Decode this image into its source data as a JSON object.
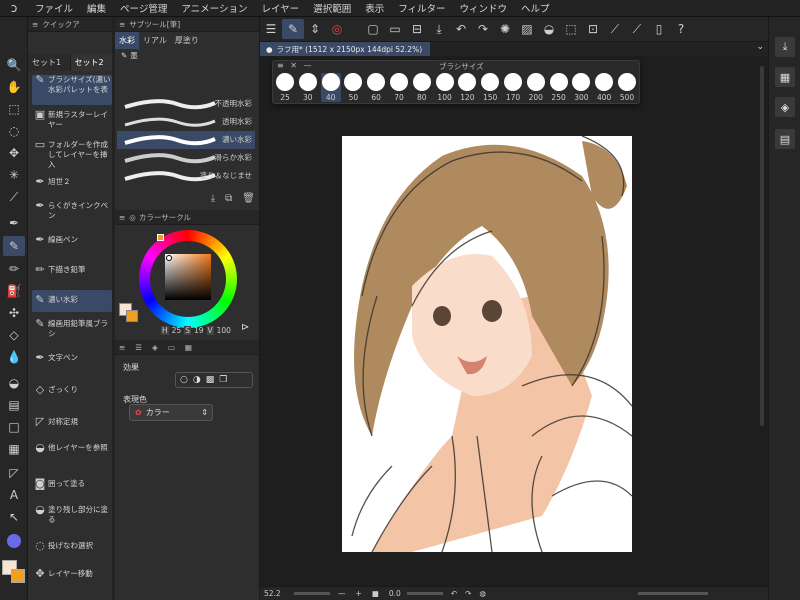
{
  "menu": {
    "items": [
      "ファイル",
      "編集",
      "ページ管理",
      "アニメーション",
      "レイヤー",
      "選択範囲",
      "表示",
      "フィルター",
      "ウィンドウ",
      "ヘルプ"
    ]
  },
  "quick_access": {
    "title": "クイックア",
    "tabs": [
      "セット1",
      "セット2"
    ],
    "items": [
      "ブラシサイズ(濃い水彩パレットを表",
      "新規ラスターレイヤー",
      "フォルダーを作成してレイヤーを挿入",
      "旭世２",
      "らくがきインクペン",
      "線画ペン",
      "下描き鉛筆",
      "濃い水彩",
      "線画用鉛筆風ブラシ",
      "文字ペン",
      "ざっくり",
      "対称定規",
      "他レイヤーを参照",
      "囲って塗る",
      "塗り残し部分に塗る",
      "投げなわ選択",
      "レイヤー移動"
    ]
  },
  "subtool": {
    "title": "サブツール[筆]",
    "tabs": [
      "水彩",
      "リアル",
      "厚塗り"
    ],
    "group": "墨",
    "brushes": [
      "不透明水彩",
      "透明水彩",
      "濃い水彩",
      "滑らか水彩",
      "塗り＆なじませ"
    ]
  },
  "color_circle": {
    "title": "カラーサークル",
    "h_label": "H",
    "h_value": "25",
    "s_label": "S",
    "s_value": "19",
    "v_label": "V",
    "v_value": "100",
    "main_color": "#fbe3d4",
    "sub_color": "#f0a020"
  },
  "properties": {
    "effect_label": "効果",
    "display_color_label": "表現色",
    "display_color_value": "カラー"
  },
  "document": {
    "tab_label": "ラフ用* (1512 x 2150px 144dpi 52.2%)"
  },
  "brush_size": {
    "title": "ブラシサイズ",
    "sizes": [
      "25",
      "30",
      "40",
      "50",
      "60",
      "70",
      "80",
      "100",
      "120",
      "150",
      "170",
      "200",
      "250",
      "300",
      "400",
      "500"
    ],
    "selected": "40"
  },
  "status": {
    "zoom": "52.2",
    "angle": "0.0"
  }
}
